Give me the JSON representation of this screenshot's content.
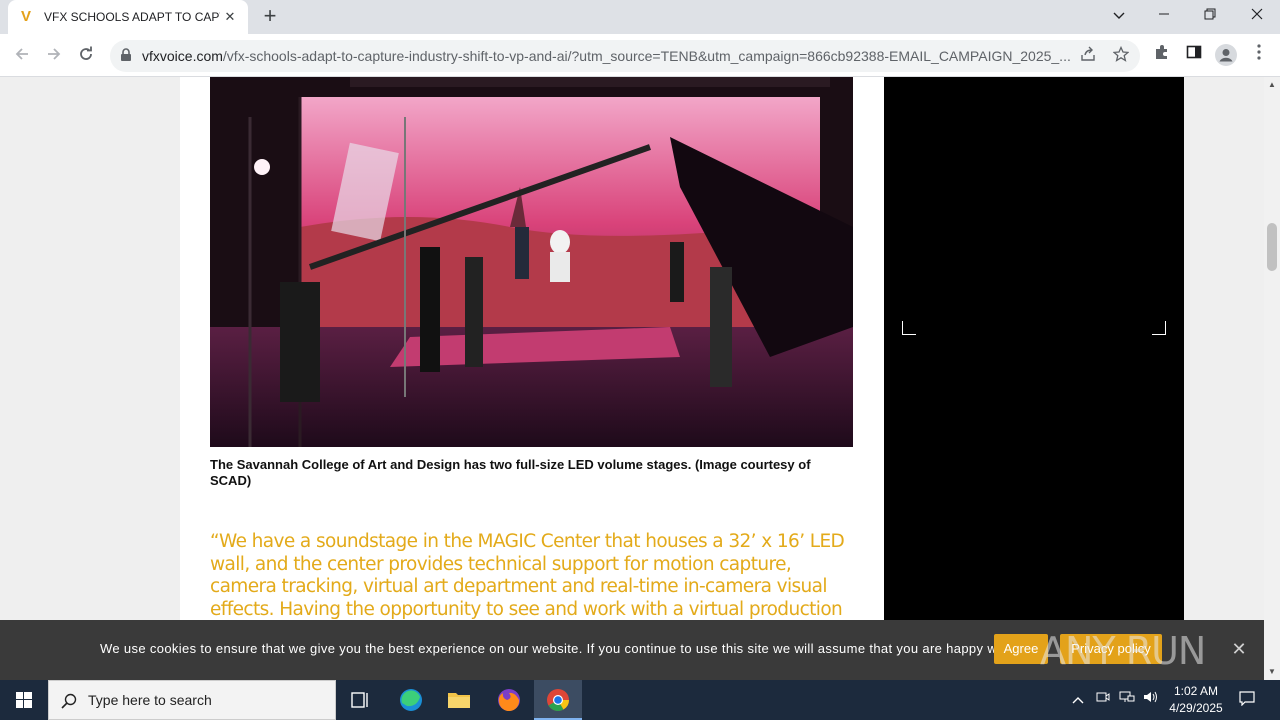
{
  "browser": {
    "tab_title": "VFX SCHOOLS ADAPT TO CAPTURE",
    "url_host": "vfxvoice.com",
    "url_path": "/vfx-schools-adapt-to-capture-industry-shift-to-vp-and-ai/?utm_source=TENB&utm_campaign=866cb92388-EMAIL_CAMPAIGN_2025_..."
  },
  "article": {
    "caption": "The Savannah College of Art and Design has two full-size LED volume stages. (Image courtesy of SCAD)",
    "quote": "“We have a soundstage in the MAGIC Center that houses a 32’ x 16’ LED wall, and the center provides technical support for motion capture, camera tracking, virtual art department and real-time in-camera visual effects. Having the opportunity to see and work with a virtual production stage is a great asset for our graduates.”"
  },
  "cookie": {
    "text": "We use cookies to ensure that we give you the best experience on our website. If you continue to use this site we will assume that you are happy with it.",
    "agree": "Agree",
    "privacy": "Privacy policy"
  },
  "watermark": {
    "text": "ANY RUN"
  },
  "taskbar": {
    "search_placeholder": "Type here to search",
    "time": "1:02 AM",
    "date": "4/29/2025"
  },
  "colors": {
    "accent_gold": "#e3aa1a",
    "taskbar": "#1c2a3d",
    "cookie_bg": "#3a3a3a"
  }
}
